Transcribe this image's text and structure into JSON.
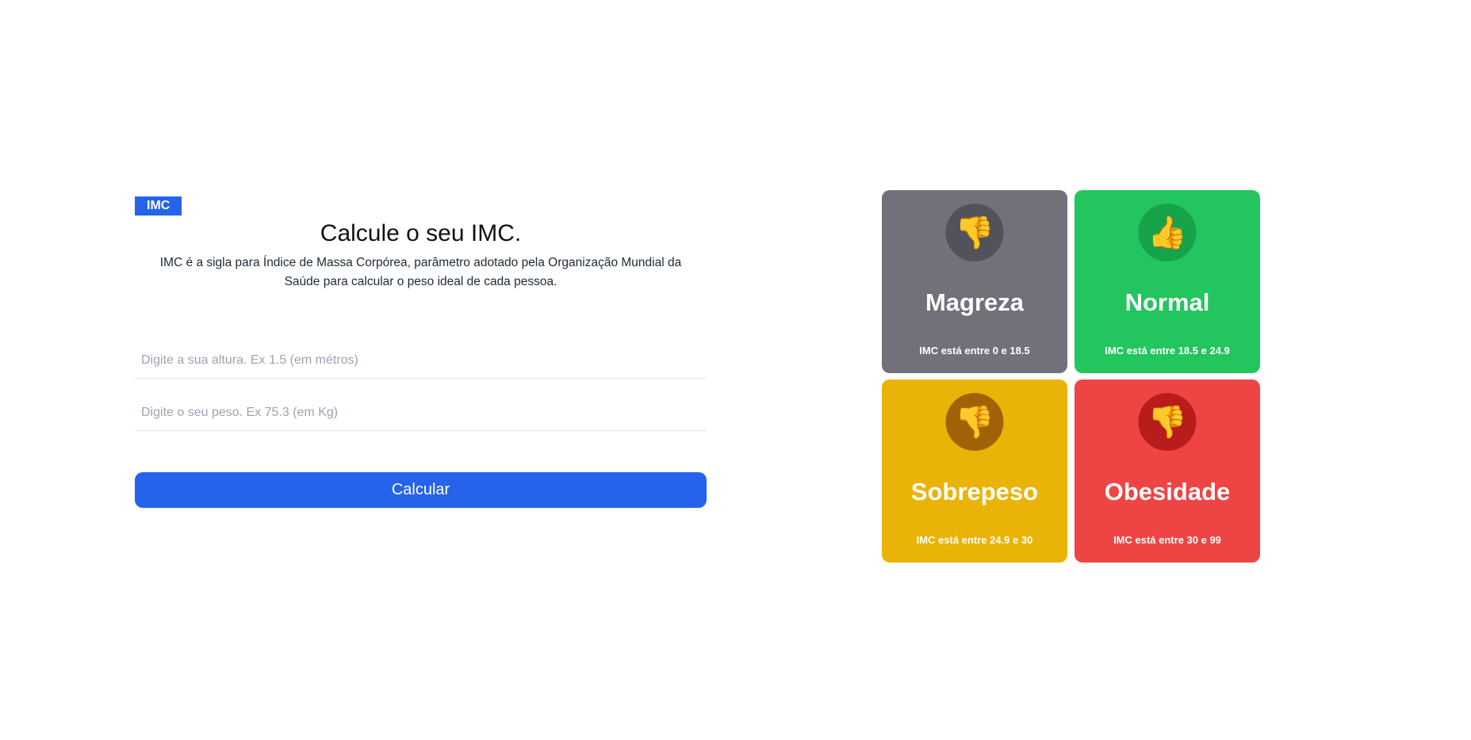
{
  "badge": "IMC",
  "heading": "Calcule o seu IMC.",
  "description": "IMC é a sigla para Índice de Massa Corpórea, parâmetro adotado pela Organização Mundial da Saúde para calcular o peso ideal de cada pessoa.",
  "form": {
    "height_placeholder": "Digite a sua altura. Ex 1.5 (em métros)",
    "weight_placeholder": "Digite o seu peso. Ex 75.3 (em Kg)",
    "height_value": "",
    "weight_value": "",
    "submit_label": "Calcular"
  },
  "colors": {
    "accent": "#2563eb"
  },
  "cards": [
    {
      "title": "Magreza",
      "range": "IMC está entre 0 e 18.5",
      "icon": "thumbs-down-icon",
      "glyph": "👎",
      "bg": "#71717a",
      "circle": "#52525b"
    },
    {
      "title": "Normal",
      "range": "IMC está entre 18.5 e 24.9",
      "icon": "thumbs-up-icon",
      "glyph": "👍",
      "bg": "#22c55e",
      "circle": "#16a34a"
    },
    {
      "title": "Sobrepeso",
      "range": "IMC está entre 24.9 e 30",
      "icon": "thumbs-down-icon",
      "glyph": "👎",
      "bg": "#eab308",
      "circle": "#a16207"
    },
    {
      "title": "Obesidade",
      "range": "IMC está entre 30 e 99",
      "icon": "thumbs-down-icon",
      "glyph": "👎",
      "bg": "#ef4444",
      "circle": "#b91c1c"
    }
  ]
}
